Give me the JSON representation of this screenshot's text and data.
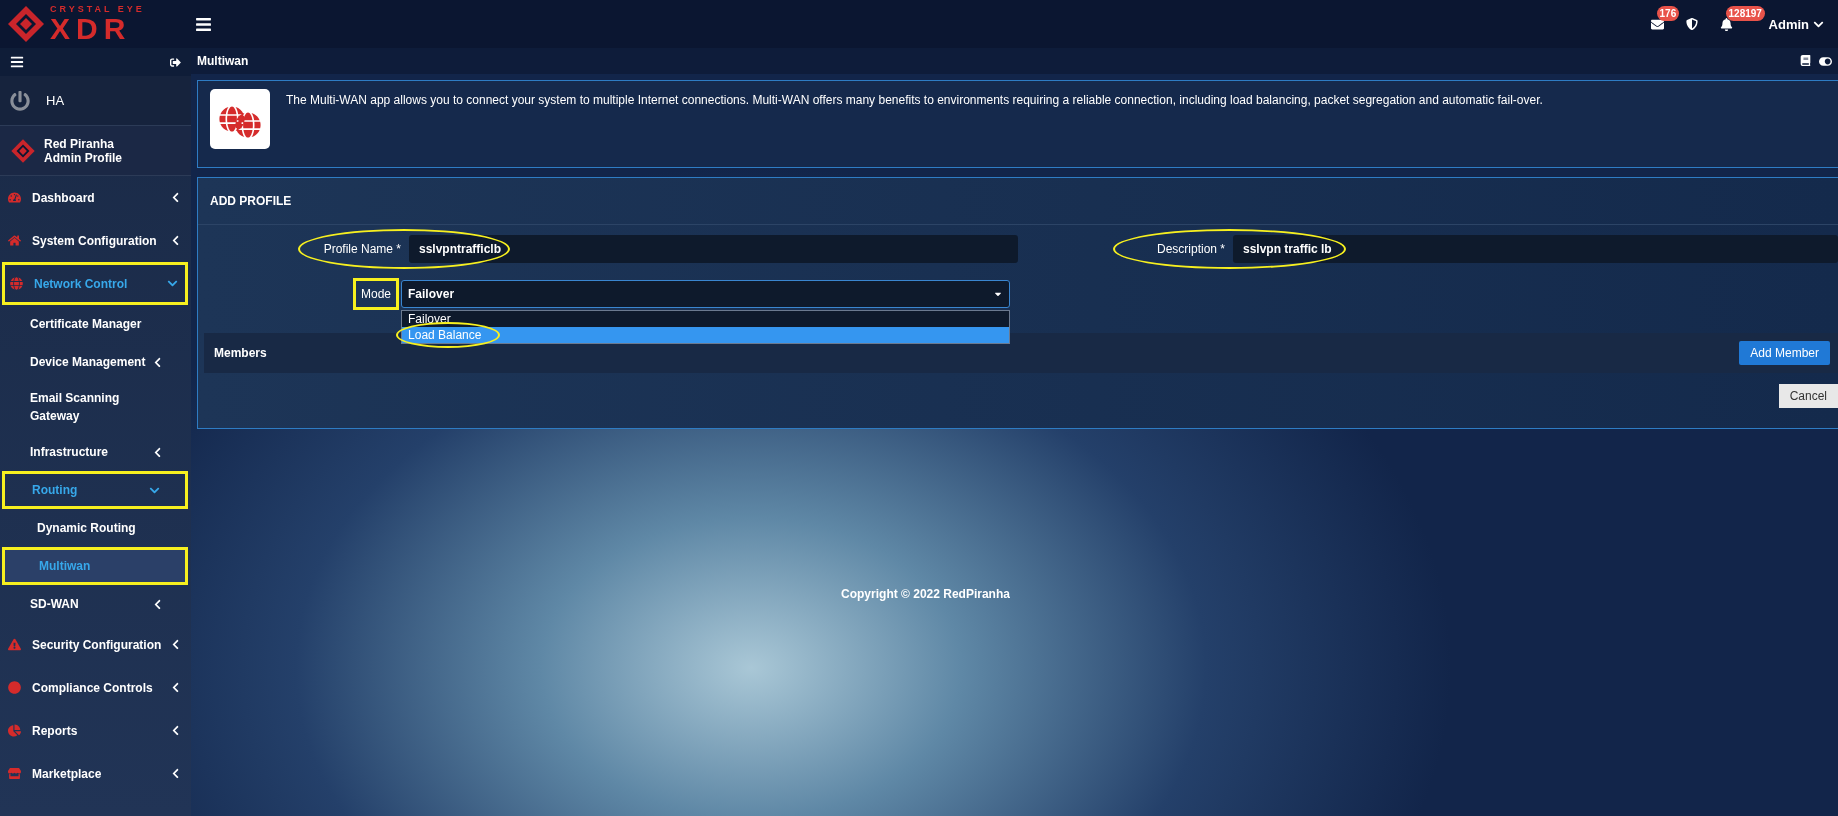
{
  "header": {
    "logo_top": "CRYSTAL EYE",
    "logo_main": "XDR",
    "mail_badge": "176",
    "bell_badge": "128197",
    "user": "Admin"
  },
  "sidebar": {
    "ha_label": "HA",
    "profile": {
      "name": "Red Piranha",
      "role": "Admin Profile"
    },
    "items": [
      {
        "label": "Dashboard",
        "expanded": false,
        "selected": false,
        "highlighted": false
      },
      {
        "label": "System Configuration",
        "expanded": false,
        "selected": false,
        "highlighted": false
      },
      {
        "label": "Network Control",
        "expanded": true,
        "selected": false,
        "highlighted": true,
        "children": [
          {
            "label": "Certificate Manager",
            "selected": false,
            "highlighted": false
          },
          {
            "label": "Device Management",
            "expanded": false,
            "selected": false,
            "highlighted": false
          },
          {
            "label": "Email Scanning Gateway",
            "selected": false,
            "highlighted": false
          },
          {
            "label": "Infrastructure",
            "expanded": false,
            "selected": false,
            "highlighted": false
          },
          {
            "label": "Routing",
            "expanded": true,
            "selected": false,
            "highlighted": true,
            "children": [
              {
                "label": "Dynamic Routing",
                "selected": false,
                "highlighted": false
              },
              {
                "label": "Multiwan",
                "selected": true,
                "highlighted": true
              }
            ]
          },
          {
            "label": "SD-WAN",
            "expanded": false,
            "selected": false,
            "highlighted": false
          }
        ]
      },
      {
        "label": "Security Configuration",
        "expanded": false,
        "selected": false,
        "highlighted": false
      },
      {
        "label": "Compliance Controls",
        "expanded": false,
        "selected": false,
        "highlighted": false
      },
      {
        "label": "Reports",
        "expanded": false,
        "selected": false,
        "highlighted": false
      },
      {
        "label": "Marketplace",
        "expanded": false,
        "selected": false,
        "highlighted": false
      }
    ]
  },
  "breadcrumb": "Multiwan",
  "info": "The Multi-WAN app allows you to connect your system to multiple Internet connections. Multi-WAN offers many benefits to environments requiring a reliable connection, including load balancing, packet segregation and automatic fail-over.",
  "form": {
    "title": "ADD PROFILE",
    "fields": [
      {
        "label": "Profile Name *",
        "value": "sslvpntrafficlb",
        "circled": true
      },
      {
        "label": "Description *",
        "value": "sslvpn traffic lb",
        "circled": true
      }
    ],
    "mode": {
      "label": "Mode",
      "value": "Failover",
      "boxed": true,
      "options": [
        {
          "label": "Failover",
          "highlighted": false,
          "circled": false
        },
        {
          "label": "Load Balance",
          "highlighted": true,
          "circled": true
        }
      ]
    },
    "members_label": "Members",
    "add_button": "Add Member",
    "cancel_button": "Cancel"
  },
  "footer": "Copyright © 2022 RedPiranha"
}
